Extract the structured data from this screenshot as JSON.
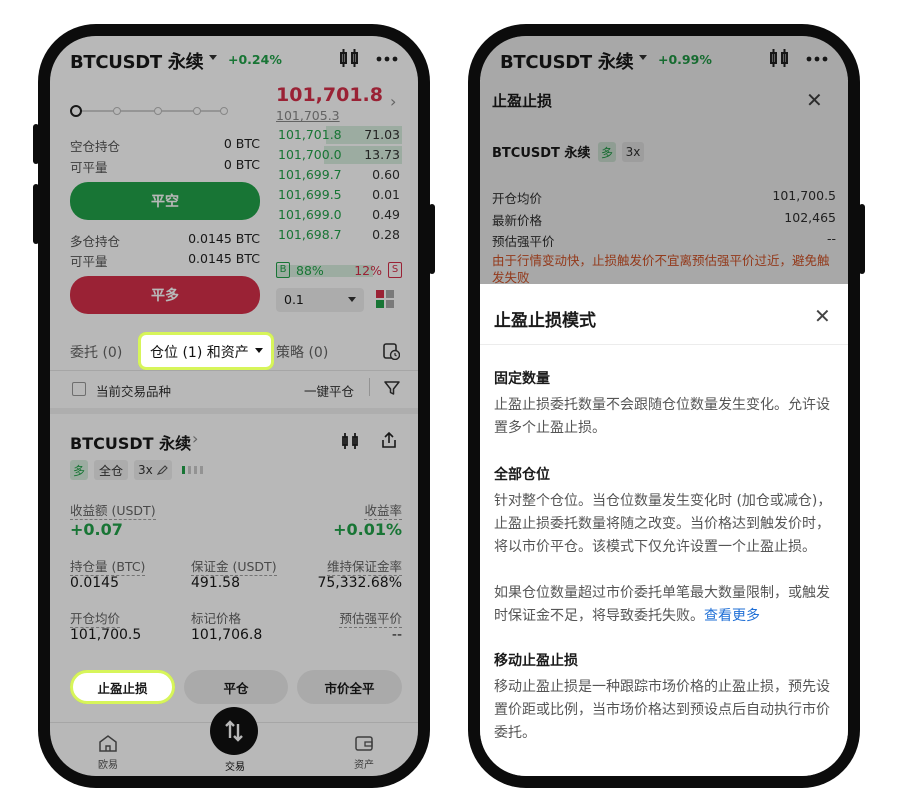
{
  "left": {
    "symbol": "BTCUSDT 永续",
    "change": "+0.24%",
    "last_price": "101,701.8",
    "mark_price": "101,705.3",
    "short_position_label": "空仓持仓",
    "short_position_value": "0 BTC",
    "short_closable_label": "可平量",
    "short_closable_value": "0 BTC",
    "close_short_button": "平空",
    "long_position_label": "多仓持仓",
    "long_position_value": "0.0145 BTC",
    "long_closable_label": "可平量",
    "long_closable_value": "0.0145 BTC",
    "close_long_button": "平多",
    "orderbook": [
      {
        "price": "101,701.8",
        "qty": "71.03",
        "depth": 0.6
      },
      {
        "price": "101,700.0",
        "qty": "13.73",
        "depth": 0.62
      },
      {
        "price": "101,699.7",
        "qty": "0.60",
        "depth": 0.0
      },
      {
        "price": "101,699.5",
        "qty": "0.01",
        "depth": 0.0
      },
      {
        "price": "101,699.0",
        "qty": "0.49",
        "depth": 0.0
      },
      {
        "price": "101,698.7",
        "qty": "0.28",
        "depth": 0.0
      }
    ],
    "buy_badge": "B",
    "buy_pct": "88%",
    "sell_pct": "12%",
    "sell_badge": "S",
    "buy_ratio": 0.88,
    "depth_select": "0.1",
    "tabs": [
      "委托 (0)",
      "仓位 (1) 和资产",
      "策略 (0)"
    ],
    "current_symbol_filter": "当前交易品种",
    "close_all_link": "一键平仓",
    "position": {
      "symbol": "BTCUSDT 永续",
      "tag_side": "多",
      "tag_margin": "全仓",
      "tag_leverage": "3x",
      "pnl_label": "收益额 (USDT)",
      "pnl_value": "+0.07",
      "roe_label": "收益率",
      "roe_value": "+0.01%",
      "size_label": "持仓量 (BTC)",
      "size_value": "0.0145",
      "margin_label": "保证金 (USDT)",
      "margin_value": "491.58",
      "mmr_label": "维持保证金率",
      "mmr_value": "75,332.68%",
      "entry_label": "开仓均价",
      "entry_value": "101,700.5",
      "markp_label": "标记价格",
      "markp_value": "101,706.8",
      "liq_label": "预估强平价",
      "liq_value": "--"
    },
    "actions": [
      "止盈止损",
      "平仓",
      "市价全平"
    ],
    "bottom_nav": [
      "欧易",
      "交易",
      "资产"
    ]
  },
  "right": {
    "symbol": "BTCUSDT 永续",
    "change": "+0.99%",
    "modal_title": "止盈止损",
    "pos_symbol": "BTCUSDT 永续",
    "pos_side": "多",
    "pos_leverage": "3x",
    "entry_label": "开仓均价",
    "entry_value": "101,700.5",
    "last_label": "最新价格",
    "last_value": "102,465",
    "liq_label": "预估强平价",
    "liq_value": "--",
    "warning": "由于行情变动快，止损触发价不宜离预估强平价过近，避免触发失败",
    "sheet_title": "止盈止损模式",
    "sections": [
      {
        "title": "固定数量",
        "body": "止盈止损委托数量不会跟随仓位数量发生变化。允许设置多个止盈止损。"
      },
      {
        "title": "全部仓位",
        "body": "针对整个仓位。当仓位数量发生变化时 (加仓或减仓)，止盈止损委托数量将随之改变。当价格达到触发价时，将以市价平仓。该模式下仅允许设置一个止盈止损。",
        "body2": "如果仓位数量超过市价委托单笔最大数量限制，或触发时保证金不足，将导致委托失败。",
        "link": "查看更多"
      },
      {
        "title": "移动止盈止损",
        "body": "移动止盈止损是一种跟踪市场价格的止盈止损，预先设置价距或比例，当市场价格达到预设点后自动执行市价委托。"
      }
    ]
  },
  "colors": {
    "green": "#22a34a",
    "red": "#d6304a",
    "highlight": "#d7f55a",
    "link": "#1f6fd6",
    "warning": "#e0582a"
  }
}
